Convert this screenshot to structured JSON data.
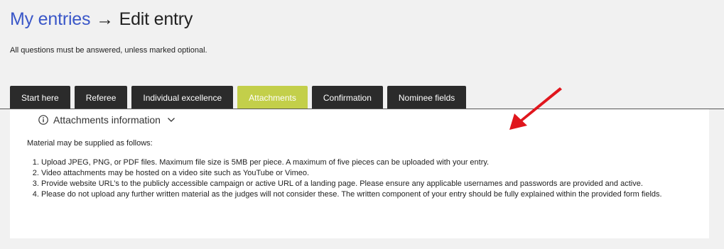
{
  "header": {
    "breadcrumb_link": "My entries",
    "breadcrumb_separator": "→",
    "breadcrumb_current": "Edit entry"
  },
  "intro_text": "All questions must be answered, unless marked optional.",
  "tabs": [
    {
      "label": "Start here",
      "active": false
    },
    {
      "label": "Referee",
      "active": false
    },
    {
      "label": "Individual excellence",
      "active": false
    },
    {
      "label": "Attachments",
      "active": true
    },
    {
      "label": "Confirmation",
      "active": false
    },
    {
      "label": "Nominee fields",
      "active": false
    }
  ],
  "attachments_info": {
    "toggle_label": "Attachments information",
    "icon": "info-icon",
    "chevron_icon": "chevron-down-icon",
    "lead": "Material may be supplied as follows:",
    "items": [
      "Upload JPEG, PNG, or PDF files. Maximum file size is 5MB per piece. A maximum of five pieces can be uploaded with your entry.",
      "Video attachments may be hosted on a video site such as YouTube or Vimeo.",
      "Provide website URL’s to the publicly accessible campaign or active URL of a landing page. Please ensure any applicable usernames and passwords are provided and active.",
      "Please do not upload any further written material as the judges will not consider these. The written component of your entry should be fully explained within the provided form fields."
    ]
  },
  "colors": {
    "link_blue": "#3a57c8",
    "tab_dark": "#2b2b2b",
    "tab_active": "#c3cf4a",
    "annotation_red": "#e0161d"
  }
}
